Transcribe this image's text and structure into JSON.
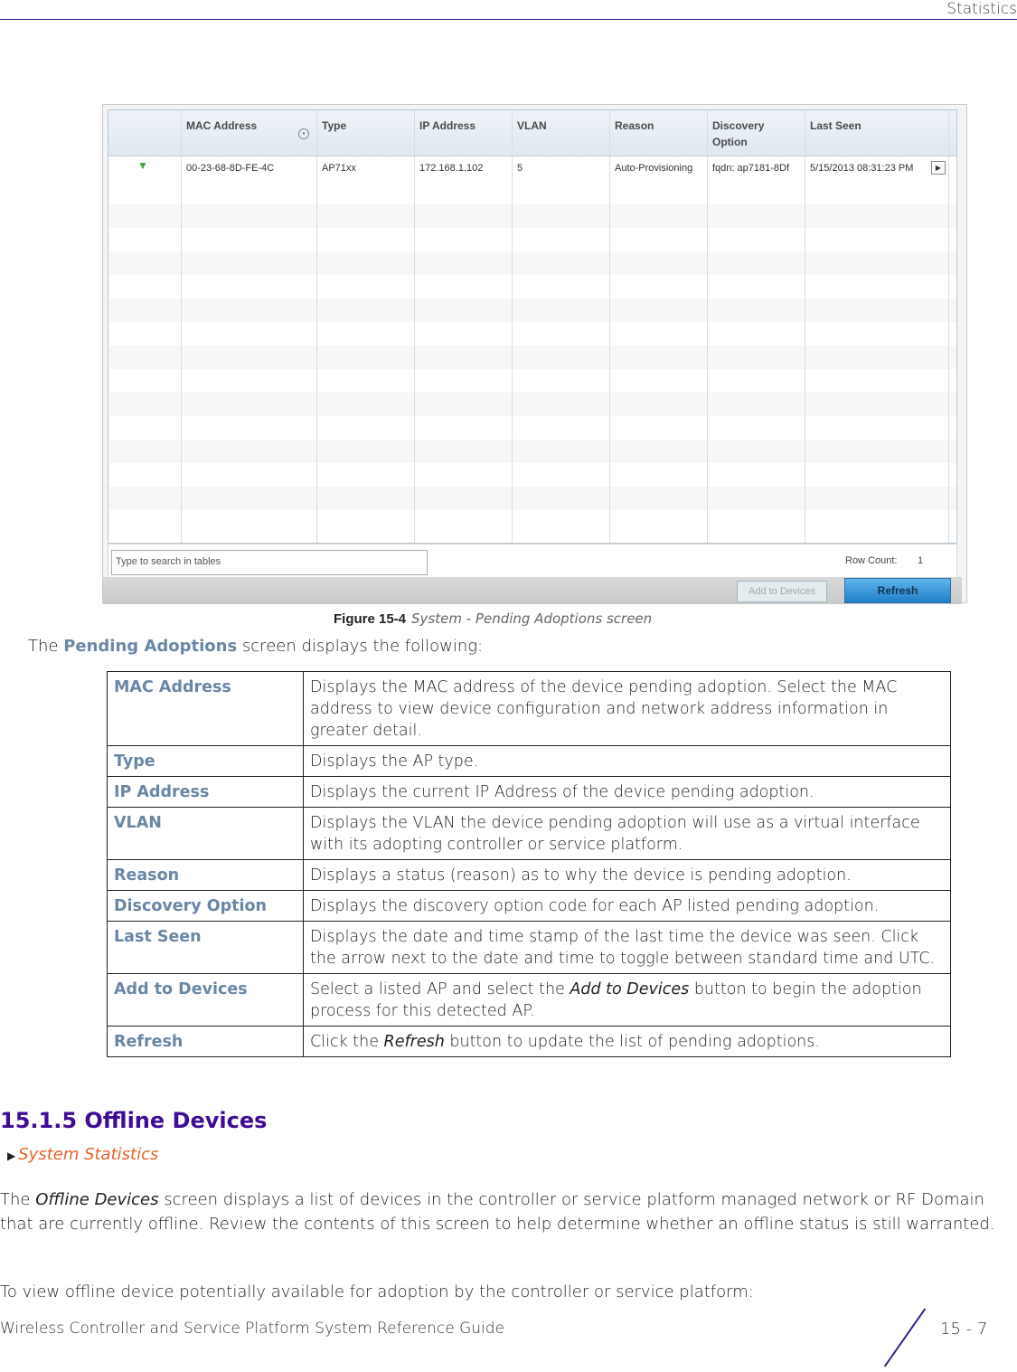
{
  "running_head": "Statistics",
  "screenshot": {
    "columns": [
      "MAC Address",
      "Type",
      "IP Address",
      "VLAN",
      "Reason",
      "Discovery\nOption",
      "Last Seen"
    ],
    "rows": [
      {
        "status_icon": "green-arrow-down-icon",
        "mac": "00-23-68-8D-FE-4C",
        "type": "AP71xx",
        "ip": "172.168.1.102",
        "vlan": "5",
        "reason": "Auto-Provisioning",
        "discovery": "fqdn: ap7181-8Df",
        "last_seen": "5/15/2013 08:31:23 PM"
      }
    ],
    "search_placeholder": "Type to search in tables",
    "row_count_label": "Row Count:",
    "row_count_value": "1",
    "add_button": "Add to Devices",
    "refresh_button": "Refresh"
  },
  "caption": {
    "label": "Figure 15-4",
    "text": "System - Pending Adoptions screen"
  },
  "intro": {
    "prefix": "The ",
    "term": "Pending Adoptions",
    "suffix": " screen displays the following:"
  },
  "definitions": [
    {
      "term": "MAC Address",
      "desc": "Displays the MAC address of the device pending adoption. Select the MAC address to view device configuration and network address information in greater detail."
    },
    {
      "term": "Type",
      "desc": "Displays the AP type."
    },
    {
      "term": "IP Address",
      "desc": "Displays the current IP Address of the device pending adoption."
    },
    {
      "term": "VLAN",
      "desc": "Displays the VLAN the device pending adoption will use as a virtual interface with its adopting controller or service platform."
    },
    {
      "term": "Reason",
      "desc": "Displays a status (reason) as to why the device is pending adoption."
    },
    {
      "term": "Discovery Option",
      "desc": "Displays the discovery option code for each AP listed pending adoption."
    },
    {
      "term": "Last Seen",
      "desc": "Displays the date and time stamp of the last time the device was seen. Click the arrow next to the date and time to toggle between standard time and UTC."
    },
    {
      "term": "Add to Devices",
      "desc_pre": "Select a listed AP and select the ",
      "desc_em": "Add to Devices",
      "desc_post": " button to begin the adoption process for this detected AP."
    },
    {
      "term": "Refresh",
      "desc_pre": "Click the ",
      "desc_em": "Refresh",
      "desc_post": " button to update the list of pending adoptions."
    }
  ],
  "section": {
    "title": "15.1.5 Offline Devices",
    "xref": "System Statistics",
    "p1_pre": "The ",
    "p1_em": "Offline Devices",
    "p1_post": " screen displays a list of devices in the controller or service platform managed network or RF Domain that are currently offline. Review the contents of this screen to help determine whether an offline status is still warranted.",
    "p2": "To view offline device potentially available for adoption by the controller or service platform:"
  },
  "footer": {
    "title": "Wireless Controller and Service Platform System Reference Guide",
    "page": "15 - 7"
  }
}
